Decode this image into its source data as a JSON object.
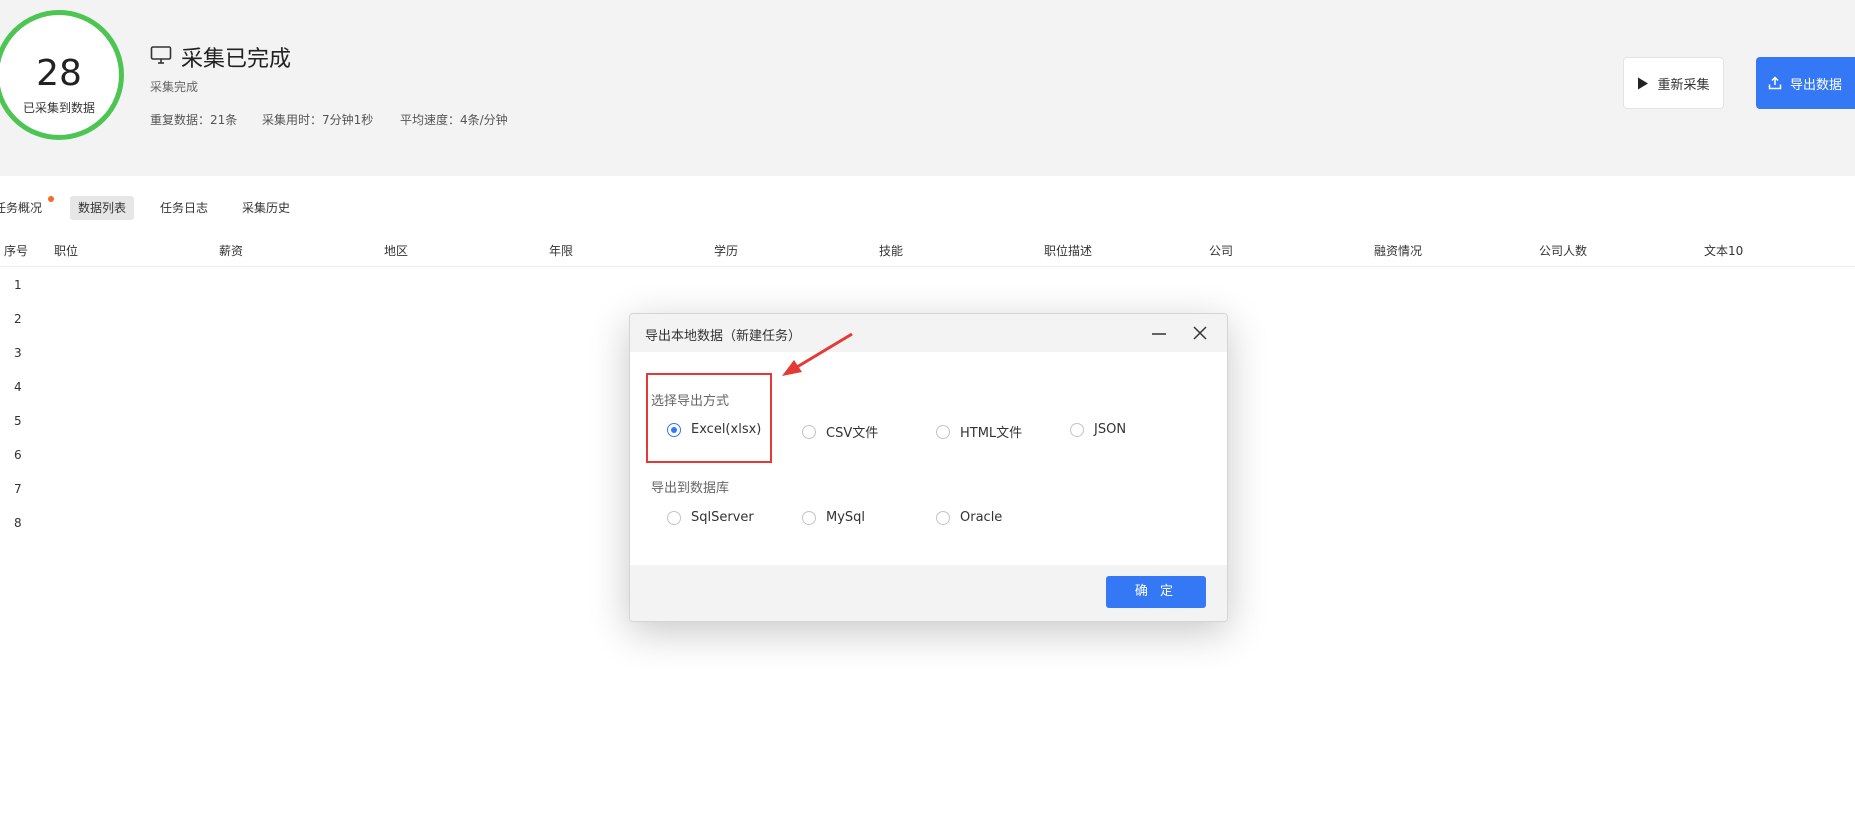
{
  "summary": {
    "count": "28",
    "count_label": "已采集到数据",
    "title": "采集已完成",
    "subtitle": "采集完成",
    "stats": [
      "重复数据：21条",
      "采集用时：7分钟1秒",
      "平均速度：4条/分钟"
    ]
  },
  "actions": {
    "restart_label": "重新采集",
    "export_label": "导出数据"
  },
  "tabs": [
    {
      "label": "任务概况",
      "badge": true
    },
    {
      "label": "数据列表",
      "active": true
    },
    {
      "label": "任务日志"
    },
    {
      "label": "采集历史"
    }
  ],
  "table": {
    "columns": [
      "序号",
      "职位",
      "薪资",
      "地区",
      "年限",
      "学历",
      "技能",
      "职位描述",
      "公司",
      "融资情况",
      "公司人数",
      "文本10"
    ],
    "row_numbers": [
      "1",
      "2",
      "3",
      "4",
      "5",
      "6",
      "7",
      "8"
    ]
  },
  "modal": {
    "title": "导出本地数据（新建任务）",
    "export_section_label": "选择导出方式",
    "export_options": [
      "Excel(xlsx)",
      "CSV文件",
      "HTML文件",
      "JSON"
    ],
    "selected_option": "Excel(xlsx)",
    "db_section_label": "导出到数据库",
    "db_options": [
      "SqlServer",
      "MySql",
      "Oracle"
    ],
    "confirm_label": "确 定"
  },
  "colors": {
    "accent": "#3478f6",
    "progress_ring": "#4cc553",
    "annotation": "#e53935",
    "badge_dot": "#f56a2c"
  }
}
